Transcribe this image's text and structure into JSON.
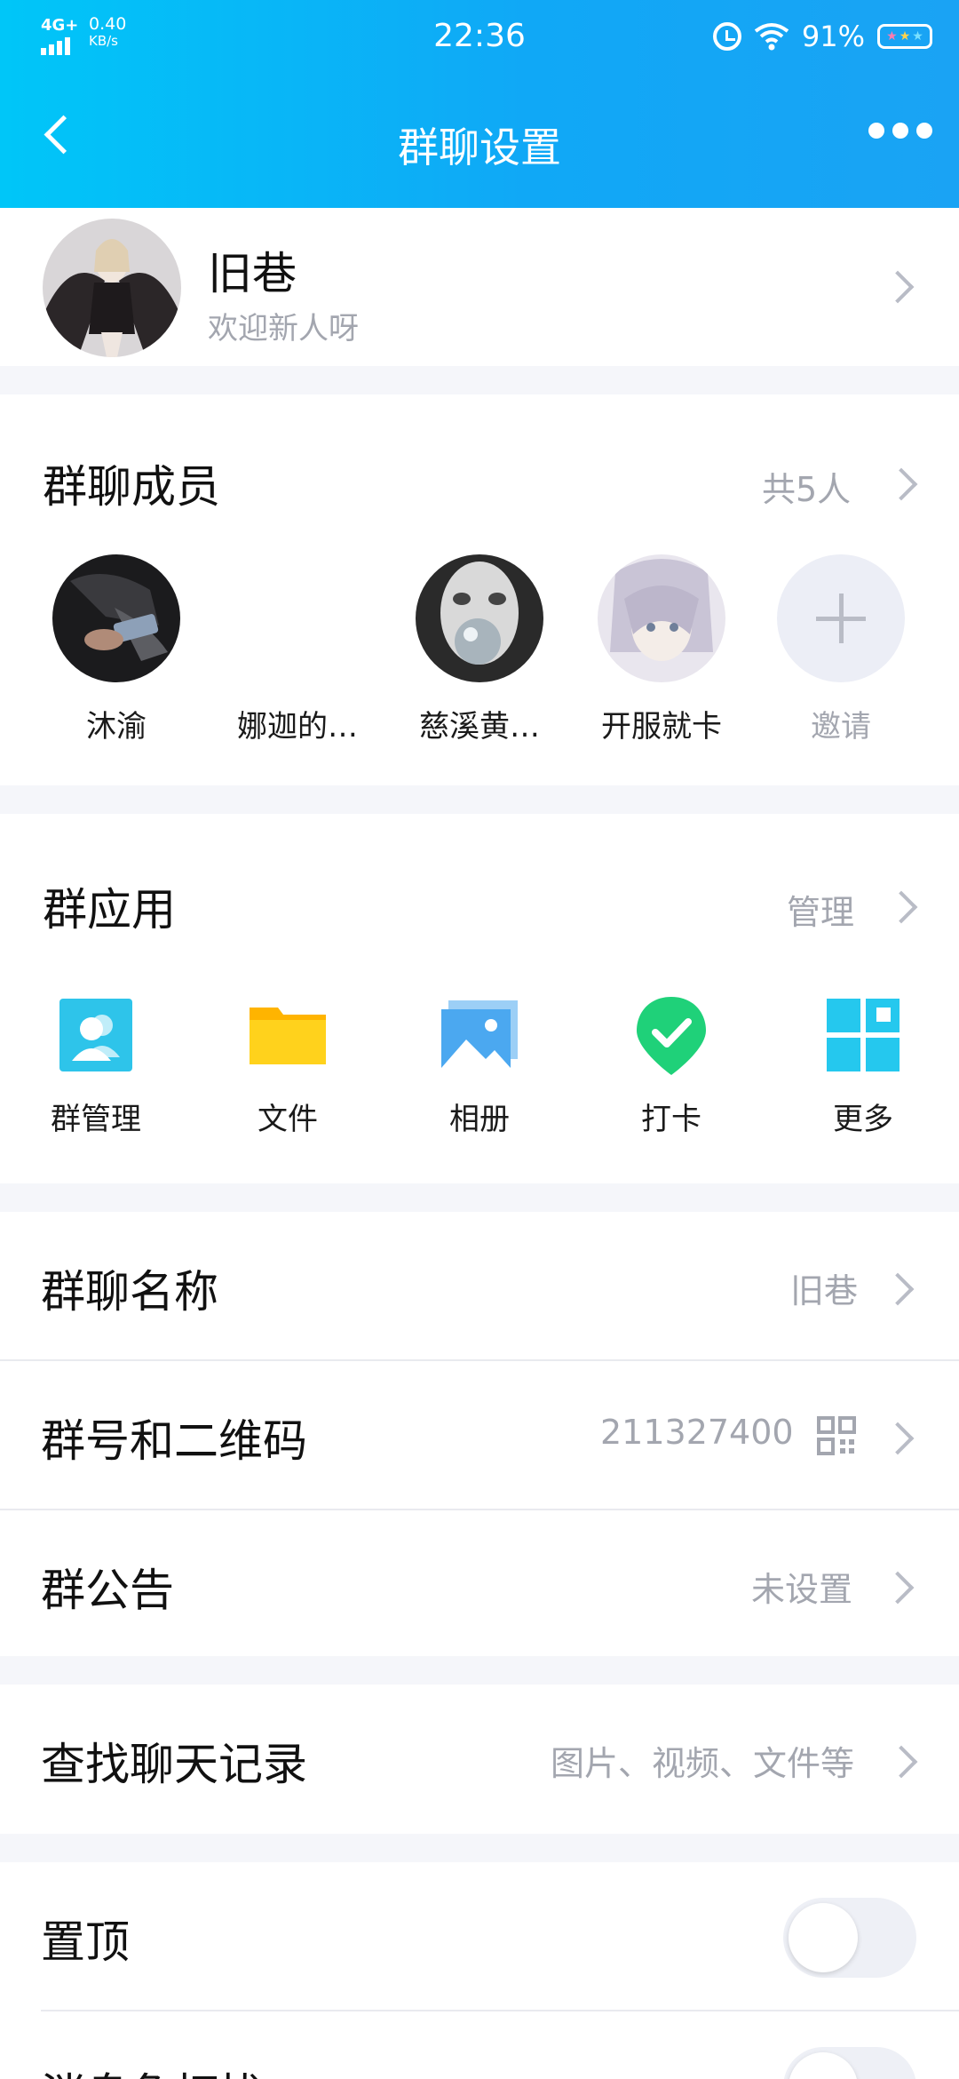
{
  "status_bar": {
    "network": "4G+",
    "speed_value": "0.40",
    "speed_unit": "KB/s",
    "time": "22:36",
    "battery_percent": "91%",
    "battery_icon": "battery-stars-icon"
  },
  "nav": {
    "title": "群聊设置",
    "back_icon": "back-chevron-icon",
    "more_icon": "more-dots-icon"
  },
  "group": {
    "name": "旧巷",
    "subtitle": "欢迎新人呀"
  },
  "members": {
    "title": "群聊成员",
    "count_label": "共5人",
    "list": [
      {
        "name": "沐渝"
      },
      {
        "name": "娜迦的…"
      },
      {
        "name": "慈溪黄…"
      },
      {
        "name": "开服就卡"
      }
    ],
    "invite_label": "邀请"
  },
  "apps": {
    "title": "群应用",
    "manage_label": "管理",
    "items": [
      {
        "label": "群管理",
        "icon": "group-manage-icon",
        "color": "#2ec4ea"
      },
      {
        "label": "文件",
        "icon": "folder-icon",
        "color": "#ffc515"
      },
      {
        "label": "相册",
        "icon": "photo-album-icon",
        "color": "#4ba8f0"
      },
      {
        "label": "打卡",
        "icon": "check-in-icon",
        "color": "#1fd179"
      },
      {
        "label": "更多",
        "icon": "more-apps-icon",
        "color": "#25c8ee"
      }
    ]
  },
  "settings": {
    "group_name": {
      "label": "群聊名称",
      "value": "旧巷"
    },
    "group_number": {
      "label": "群号和二维码",
      "value": "211327400"
    },
    "announcement": {
      "label": "群公告",
      "value": "未设置"
    },
    "search_history": {
      "label": "查找聊天记录",
      "value": "图片、视频、文件等"
    },
    "pin_top": {
      "label": "置顶",
      "enabled": false
    },
    "do_not_disturb": {
      "label": "消息免打扰",
      "enabled": false
    }
  },
  "colors": {
    "header_start": "#00c6f8",
    "header_end": "#1aa3f4",
    "secondary_text": "#a3a6af",
    "background": "#f5f6fa"
  }
}
